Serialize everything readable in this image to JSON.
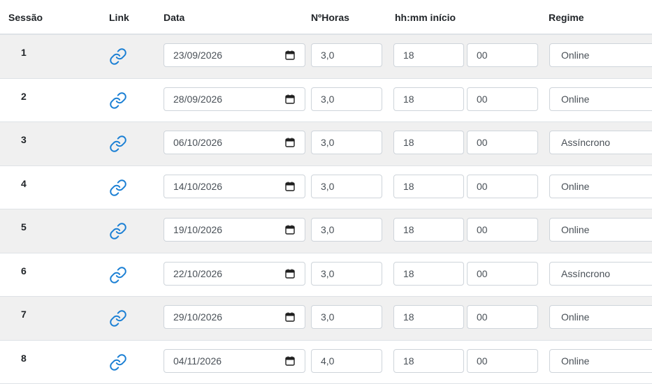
{
  "table": {
    "headers": {
      "session": "Sessão",
      "link": "Link",
      "date": "Data",
      "hours": "NºHoras",
      "start": "hh:mm início",
      "regime": "Regime"
    },
    "rows": [
      {
        "session": "1",
        "date": "23/09/2026",
        "hours": "3,0",
        "hh": "18",
        "mm": "00",
        "regime": "Online"
      },
      {
        "session": "2",
        "date": "28/09/2026",
        "hours": "3,0",
        "hh": "18",
        "mm": "00",
        "regime": "Online"
      },
      {
        "session": "3",
        "date": "06/10/2026",
        "hours": "3,0",
        "hh": "18",
        "mm": "00",
        "regime": "Assíncrono"
      },
      {
        "session": "4",
        "date": "14/10/2026",
        "hours": "3,0",
        "hh": "18",
        "mm": "00",
        "regime": "Online"
      },
      {
        "session": "5",
        "date": "19/10/2026",
        "hours": "3,0",
        "hh": "18",
        "mm": "00",
        "regime": "Online"
      },
      {
        "session": "6",
        "date": "22/10/2026",
        "hours": "3,0",
        "hh": "18",
        "mm": "00",
        "regime": "Assíncrono"
      },
      {
        "session": "7",
        "date": "29/10/2026",
        "hours": "3,0",
        "hh": "18",
        "mm": "00",
        "regime": "Online"
      },
      {
        "session": "8",
        "date": "04/11/2026",
        "hours": "4,0",
        "hh": "18",
        "mm": "00",
        "regime": "Online"
      }
    ]
  },
  "icons": {
    "link": "link-icon",
    "calendar": "calendar-icon"
  },
  "colors": {
    "link_icon": "#1a7fd4",
    "stripe": "#f0f0f0",
    "border": "#ced4da"
  }
}
